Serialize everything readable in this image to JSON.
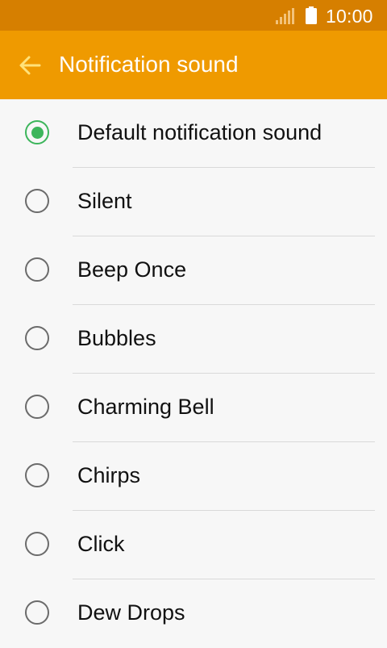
{
  "status_bar": {
    "time": "10:00",
    "signal_icon": "signal-bars-icon",
    "battery_icon": "battery-icon",
    "background": "#d67f00"
  },
  "app_bar": {
    "title": "Notification sound",
    "back_icon": "arrow-left-icon",
    "background": "#ef9a00",
    "icon_color": "#ffe27a"
  },
  "sounds": {
    "accent": "#3cb55b",
    "items": [
      {
        "label": "Default notification sound",
        "selected": true
      },
      {
        "label": "Silent",
        "selected": false
      },
      {
        "label": "Beep Once",
        "selected": false
      },
      {
        "label": "Bubbles",
        "selected": false
      },
      {
        "label": "Charming Bell",
        "selected": false
      },
      {
        "label": "Chirps",
        "selected": false
      },
      {
        "label": "Click",
        "selected": false
      },
      {
        "label": "Dew Drops",
        "selected": false
      }
    ]
  }
}
